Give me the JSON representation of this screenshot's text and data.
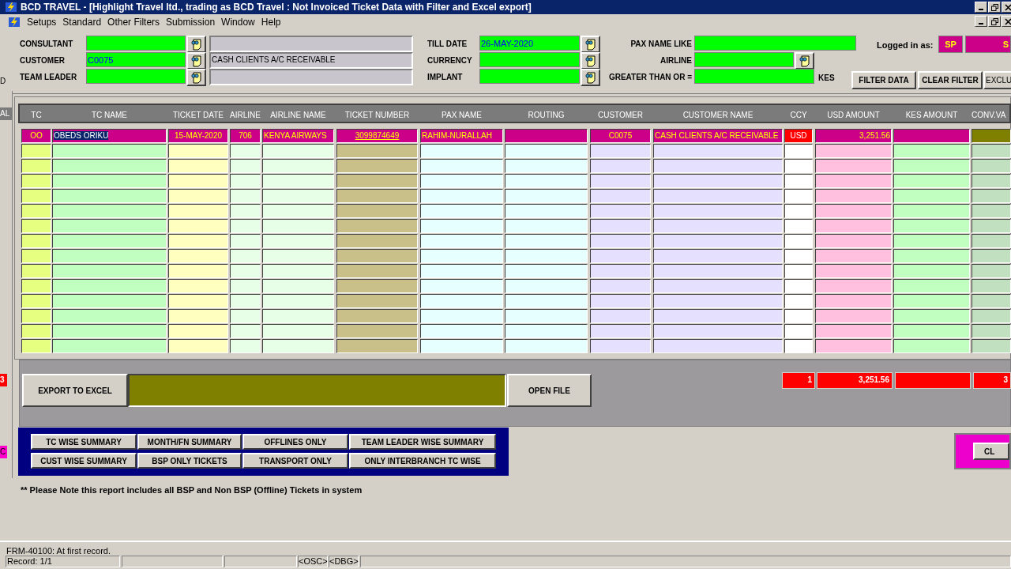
{
  "window": {
    "title": "BCD TRAVEL - [Highlight Travel ltd., trading as BCD Travel : Not Invoiced Ticket Data with Filter and Excel export]"
  },
  "menu": [
    "Setups",
    "Standard",
    "Other Filters",
    "Submission",
    "Window",
    "Help"
  ],
  "background_window": {
    "fragments": [
      "D",
      "AL",
      "3",
      "C"
    ]
  },
  "filters_left": [
    {
      "label": "CONSULTANT"
    },
    {
      "label": "CUSTOMER",
      "value": "C0075",
      "description": "CASH CLIENTS A/C RECEIVABLE"
    },
    {
      "label": "TEAM LEADER"
    }
  ],
  "filters_mid": [
    {
      "label": "TILL DATE",
      "value": "26-MAY-2020"
    },
    {
      "label": "CURRENCY"
    },
    {
      "label": "IMPLANT"
    }
  ],
  "filters_right": [
    {
      "label": "PAX NAME LIKE",
      "lookup": false
    },
    {
      "label": "AIRLINE",
      "lookup": true
    },
    {
      "label": "GREATER THAN OR =",
      "lookup": false,
      "unit": "KES"
    }
  ],
  "login": {
    "label": "Logged in as:",
    "user": "SP",
    "name": "S"
  },
  "filter_buttons": [
    "FILTER DATA",
    "CLEAR FILTER",
    "EXCLU"
  ],
  "table": {
    "columns": [
      "TC",
      "TC NAME",
      "TICKET DATE",
      "AIRLINE",
      "AIRLINE NAME",
      "TICKET NUMBER",
      "PAX NAME",
      "ROUTING",
      "CUSTOMER",
      "CUSTOMER NAME",
      "CCY",
      "USD AMOUNT",
      "KES AMOUNT",
      "CONV.VA"
    ],
    "rows": [
      {
        "current": true,
        "cells": [
          {
            "text": "OO"
          },
          {
            "text": "OBEDS ORIKU"
          },
          {
            "text": "15-MAY-2020"
          },
          {
            "text": "706"
          },
          {
            "text": "KENYA AIRWAYS"
          },
          {
            "text": "3099874649"
          },
          {
            "text": "RAHIM-NURALLAH"
          },
          {},
          {
            "text": "C0075"
          },
          {
            "text": "CASH CLIENTS A/C RECEIVABLE"
          },
          {
            "text": "USD"
          },
          {
            "text": "3,251.56"
          },
          {},
          {}
        ]
      },
      {
        "current": false
      },
      {
        "current": false
      },
      {
        "current": false
      },
      {
        "current": false
      },
      {
        "current": false
      },
      {
        "current": false
      },
      {
        "current": false
      },
      {
        "current": false
      },
      {
        "current": false
      },
      {
        "current": false
      },
      {
        "current": false
      },
      {
        "current": false
      },
      {
        "current": false
      },
      {
        "current": false
      }
    ]
  },
  "totals": {
    "ccy": "1",
    "usd_amount": "3,251.56",
    "conv_va": "3"
  },
  "export": {
    "button": "EXPORT TO EXCEL",
    "open_button": "OPEN FILE"
  },
  "summary_buttons": [
    "TC WISE SUMMARY",
    "MONTH/FN SUMMARY",
    "OFFLINES ONLY",
    "TEAM LEADER WISE SUMMARY",
    "CUST WISE SUMMARY",
    "BSP ONLY TICKETS",
    "TRANSPORT ONLY",
    "ONLY INTERBRANCH TC WISE"
  ],
  "close_button": "CL",
  "note": "** Please Note this report includes all BSP and Non BSP (Offline) Tickets in system",
  "status_bar": {
    "message": "FRM-40100: At first record.",
    "record": "Record: 1/1",
    "flags": [
      "<OSC>",
      "<DBG>"
    ]
  }
}
